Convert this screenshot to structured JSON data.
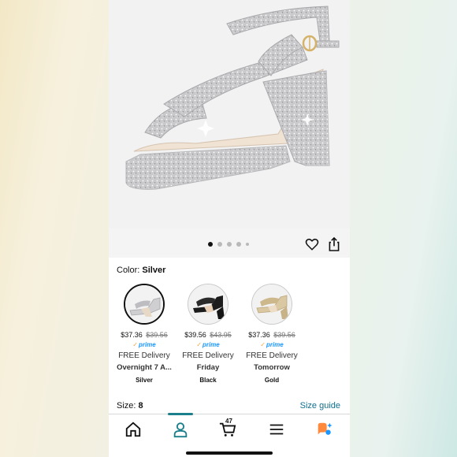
{
  "product": {
    "gallery": {
      "image_count": 5,
      "active_index": 0
    }
  },
  "color": {
    "label": "Color:",
    "value": "Silver"
  },
  "variants": [
    {
      "price": "$37.36",
      "list_price": "$39.56",
      "prime": "prime",
      "delivery": "FREE Delivery",
      "day": "Overnight 7 A...",
      "name": "Silver",
      "selected": true
    },
    {
      "price": "$39.56",
      "list_price": "$43.95",
      "prime": "prime",
      "delivery": "FREE Delivery",
      "day": "Friday",
      "name": "Black",
      "selected": false
    },
    {
      "price": "$37.36",
      "list_price": "$39.56",
      "prime": "prime",
      "delivery": "FREE Delivery",
      "day": "Tomorrow",
      "name": "Gold",
      "selected": false
    }
  ],
  "size": {
    "label": "Size:",
    "value": "8",
    "guide": "Size guide"
  },
  "nav": {
    "cart_count": "47",
    "active": "account"
  },
  "colors": {
    "accent": "#1c7f8c",
    "link": "#0f6f8f",
    "prime": "#1a98ff"
  }
}
